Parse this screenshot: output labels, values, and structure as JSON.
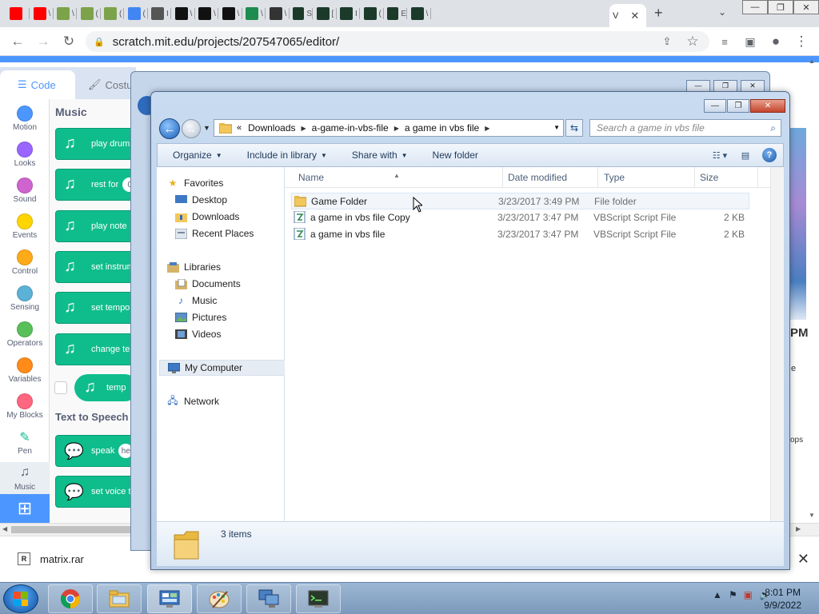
{
  "browser": {
    "tabs": [
      {
        "name": "youtube-tab",
        "icon": "youtube-icon",
        "color": "#ff0000",
        "glyph": ""
      },
      {
        "name": "youtube-tab-2",
        "icon": "youtube-icon",
        "color": "#ff0000",
        "glyph": "\\"
      },
      {
        "name": "scratch-tab-1",
        "icon": "puzzle-icon",
        "color": "#7ca34a",
        "glyph": "\\"
      },
      {
        "name": "scratch-tab-2",
        "icon": "puzzle-icon",
        "color": "#7ca34a",
        "glyph": "("
      },
      {
        "name": "scratch-tab-3",
        "icon": "puzzle-icon",
        "color": "#7ca34a",
        "glyph": "("
      },
      {
        "name": "google-tab",
        "icon": "google-icon",
        "color": "#4285f4",
        "glyph": "("
      },
      {
        "name": "web-tab",
        "icon": "globe-icon",
        "color": "#555555",
        "glyph": "I"
      },
      {
        "name": "wiki-tab-1",
        "icon": "w-icon",
        "color": "#111111",
        "glyph": "\\"
      },
      {
        "name": "wiki-tab-2",
        "icon": "w-icon",
        "color": "#111111",
        "glyph": "\\"
      },
      {
        "name": "wiki-tab-3",
        "icon": "w-icon",
        "color": "#111111",
        "glyph": "\\"
      },
      {
        "name": "sheet-tab",
        "icon": "spreadsheet-icon",
        "color": "#1e8c4e",
        "glyph": "\\"
      },
      {
        "name": "archive-tab",
        "icon": "bank-icon",
        "color": "#333333",
        "glyph": "\\"
      },
      {
        "name": "bolt-tab-1",
        "icon": "bolt-icon",
        "color": "#1b3a2a",
        "glyph": "S"
      },
      {
        "name": "bolt-tab-2",
        "icon": "bolt-icon",
        "color": "#1b3a2a",
        "glyph": "["
      },
      {
        "name": "bolt-tab-3",
        "icon": "bolt-icon",
        "color": "#1b3a2a",
        "glyph": "I"
      },
      {
        "name": "bolt-tab-4",
        "icon": "bolt-icon",
        "color": "#1b3a2a",
        "glyph": "("
      },
      {
        "name": "bolt-tab-5",
        "icon": "bolt-icon",
        "color": "#1b3a2a",
        "glyph": "E"
      },
      {
        "name": "bolt-tab-6",
        "icon": "bolt-icon",
        "color": "#1b3a2a",
        "glyph": "\\"
      }
    ],
    "active_tab_glyph": "V",
    "url": "scratch.mit.edu/projects/207547065/editor/"
  },
  "scratch": {
    "tabs": {
      "code": "Code",
      "costumes": "Costu"
    },
    "categories": [
      {
        "label": "Motion",
        "color": "#4c97ff"
      },
      {
        "label": "Looks",
        "color": "#9966ff"
      },
      {
        "label": "Sound",
        "color": "#cf63cf"
      },
      {
        "label": "Events",
        "color": "#ffd500"
      },
      {
        "label": "Control",
        "color": "#ffab19"
      },
      {
        "label": "Sensing",
        "color": "#5cb1d6"
      },
      {
        "label": "Operators",
        "color": "#59c059"
      },
      {
        "label": "Variables",
        "color": "#ff8c1a"
      },
      {
        "label": "My Blocks",
        "color": "#ff6680"
      },
      {
        "label": "Pen",
        "color": "#0fbd8c"
      },
      {
        "label": "Music",
        "color": "#0fbd8c"
      }
    ],
    "palette": {
      "music_heading": "Music",
      "blocks": [
        "play drum",
        "rest for",
        "play note",
        "set instrum",
        "set tempo",
        "change ten"
      ],
      "rest_slot": "0",
      "reporter": "temp",
      "tts_heading": "Text to Speech",
      "tts_blocks": [
        "speak",
        "set voice to"
      ],
      "speak_slot": "he"
    },
    "stage_fragments": {
      "pm": "PM",
      "e": "e",
      "ops": "ops"
    }
  },
  "download_bar": {
    "file": "matrix.rar",
    "icon_text": "R"
  },
  "explorer": {
    "breadcrumbs": [
      "Downloads",
      "a-game-in-vbs-file",
      "a game in vbs file"
    ],
    "search_placeholder": "Search a game in vbs file",
    "commands": [
      "Organize",
      "Include in library",
      "Share with",
      "New folder"
    ],
    "nav": {
      "favorites": "Favorites",
      "desktop": "Desktop",
      "downloads": "Downloads",
      "recent": "Recent Places",
      "libraries": "Libraries",
      "documents": "Documents",
      "music": "Music",
      "pictures": "Pictures",
      "videos": "Videos",
      "computer": "My Computer",
      "network": "Network"
    },
    "columns": {
      "name": "Name",
      "date": "Date modified",
      "type": "Type",
      "size": "Size"
    },
    "files": [
      {
        "name": "Game Folder",
        "date": "3/23/2017 3:49 PM",
        "type": "File folder",
        "size": "",
        "icon": "folder-icon"
      },
      {
        "name": "a game in vbs file Copy",
        "date": "3/23/2017 3:47 PM",
        "type": "VBScript Script File",
        "size": "2 KB",
        "icon": "vbscript-file-icon"
      },
      {
        "name": "a game in vbs file",
        "date": "3/23/2017 3:47 PM",
        "type": "VBScript Script File",
        "size": "2 KB",
        "icon": "vbscript-file-icon"
      }
    ],
    "item_count": "3 items"
  },
  "taskbar": {
    "apps": [
      "chrome-icon",
      "file-explorer-icon",
      "control-panel-icon",
      "paint-icon",
      "network-computer-icon",
      "terminal-icon"
    ],
    "time": "8:01 PM",
    "date": "9/9/2022"
  },
  "colors": {
    "scratch_blue": "#4c97ff",
    "music_green": "#0fbd8c",
    "close_red": "#c4452c"
  }
}
